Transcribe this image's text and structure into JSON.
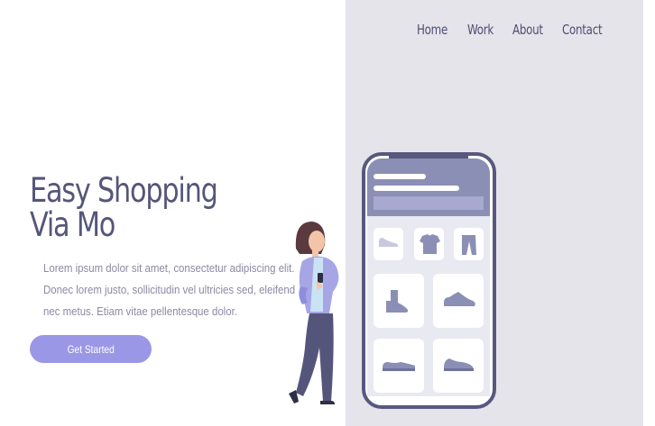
{
  "nav": {
    "items": [
      {
        "label": "Home"
      },
      {
        "label": "Work"
      },
      {
        "label": "About"
      },
      {
        "label": "Contact"
      }
    ]
  },
  "hero": {
    "title_line1": "Easy Shopping",
    "title_line2": "Via Mo",
    "description": "Lorem ipsum dolor sit amet, consectetur adipiscing elit. Donec lorem justo, sollicitudin vel ultricies sed, eleifend nec metus. Etiam vitae pellentesque dolor.",
    "cta_label": "Get Started"
  },
  "colors": {
    "accent": "#9a98e6",
    "text_dark": "#56567a",
    "panel_bg": "#e5e4ea",
    "phone_frame": "#58587e"
  },
  "illustration": {
    "icons": [
      "slipper-icon",
      "tshirt-icon",
      "pants-icon",
      "boot-icon",
      "sneaker-icon",
      "flat-shoe-icon",
      "sneaker-alt-icon"
    ]
  }
}
